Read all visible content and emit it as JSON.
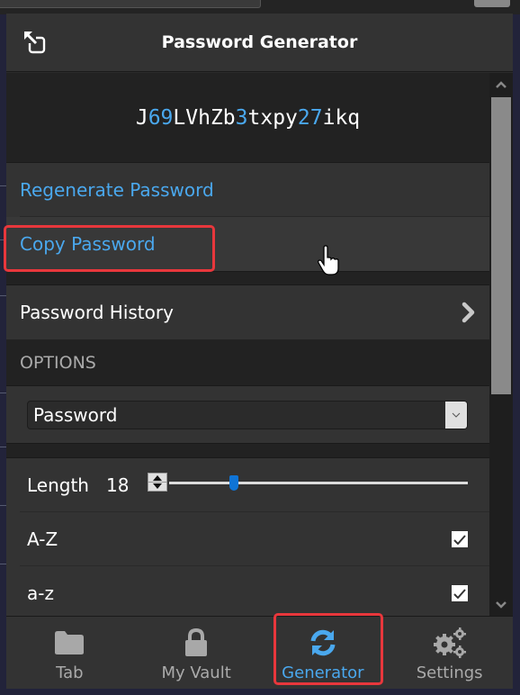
{
  "header": {
    "title": "Password Generator",
    "popout_icon": "popout-icon"
  },
  "password": {
    "segments": [
      {
        "text": "J",
        "type": "letter"
      },
      {
        "text": "69",
        "type": "number"
      },
      {
        "text": "LVhZb",
        "type": "letter"
      },
      {
        "text": "3",
        "type": "number"
      },
      {
        "text": "txpy",
        "type": "letter"
      },
      {
        "text": "27",
        "type": "number"
      },
      {
        "text": "ikq",
        "type": "letter"
      }
    ],
    "value": "J69LVhZb3txpy27ikq"
  },
  "actions": {
    "regenerate_label": "Regenerate Password",
    "copy_label": "Copy Password",
    "history_label": "Password History"
  },
  "options": {
    "section_label": "OPTIONS",
    "type_selected": "Password",
    "length_label": "Length",
    "length_value": "18",
    "length_slider": {
      "value": 18,
      "min": 5,
      "max": 128
    },
    "uppercase_label": "A-Z",
    "uppercase_checked": true,
    "lowercase_label": "a-z",
    "lowercase_checked": true
  },
  "footer": {
    "tabs": [
      {
        "label": "Tab",
        "icon": "folder-icon",
        "active": false
      },
      {
        "label": "My Vault",
        "icon": "lock-icon",
        "active": false
      },
      {
        "label": "Generator",
        "icon": "refresh-icon",
        "active": true
      },
      {
        "label": "Settings",
        "icon": "gears-icon",
        "active": false
      }
    ]
  },
  "colors": {
    "accent": "#4aa8ee",
    "highlight": "#e8373c",
    "slider_thumb": "#0f74d6"
  }
}
